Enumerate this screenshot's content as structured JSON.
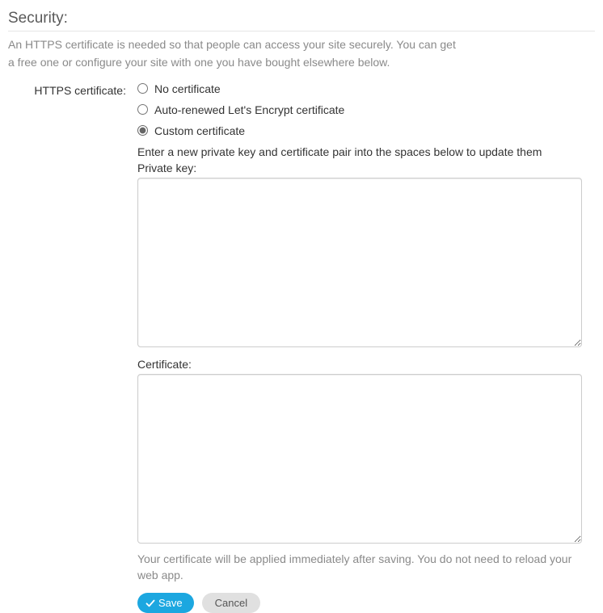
{
  "section": {
    "title": "Security:",
    "description_line1": "An HTTPS certificate is needed so that people can access your site securely. You can get",
    "description_line2": "a free one or configure your site with one you have bought elsewhere below."
  },
  "https": {
    "field_label": "HTTPS certificate:",
    "options": {
      "none": "No certificate",
      "letsencrypt": "Auto-renewed Let's Encrypt certificate",
      "custom": "Custom certificate"
    },
    "selected": "custom",
    "custom": {
      "instruction": "Enter a new private key and certificate pair into the spaces below to update them",
      "private_key_label": "Private key:",
      "private_key_value": "",
      "certificate_label": "Certificate:",
      "certificate_value": "",
      "help_text": "Your certificate will be applied immediately after saving. You do not need to reload your web app."
    }
  },
  "buttons": {
    "save": "Save",
    "cancel": "Cancel"
  }
}
